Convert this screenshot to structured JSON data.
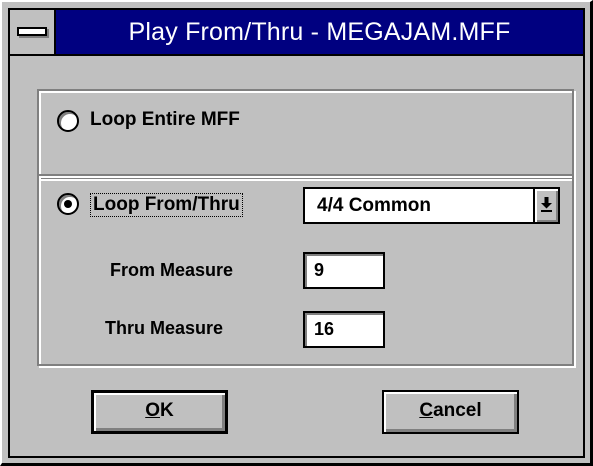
{
  "window": {
    "title": "Play From/Thru - MEGAJAM.MFF",
    "colors": {
      "titlebar": "#000080",
      "face": "#c0c0c0",
      "field": "#ffffff"
    }
  },
  "options": {
    "loop_entire": {
      "label": "Loop Entire MFF",
      "selected": false
    },
    "loop_from_thru": {
      "label": "Loop From/Thru",
      "selected": true
    }
  },
  "time_signature": {
    "selected": "4/4 Common",
    "icon": "dropdown-arrow-icon"
  },
  "from_measure": {
    "label": "From Measure",
    "value": "9"
  },
  "thru_measure": {
    "label": "Thru Measure",
    "value": "16"
  },
  "buttons": {
    "ok": {
      "mnemonic": "O",
      "rest": "K"
    },
    "cancel": {
      "mnemonic": "C",
      "rest": "ancel"
    }
  }
}
